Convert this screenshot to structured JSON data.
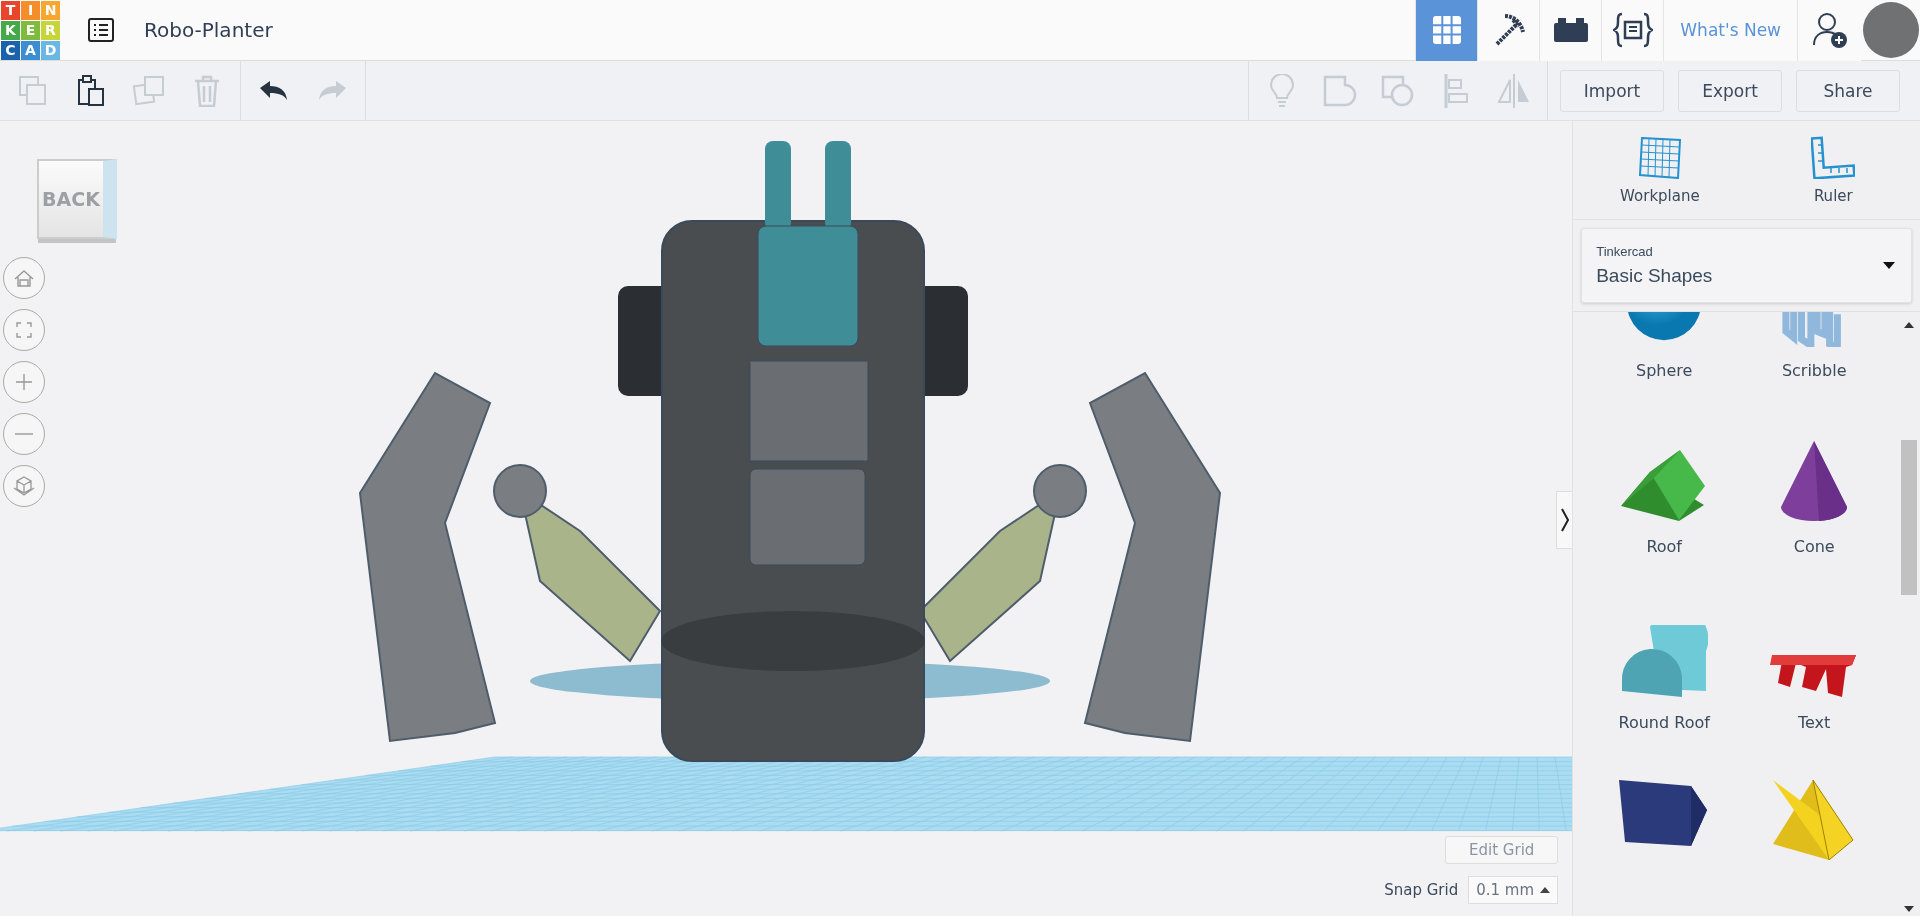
{
  "header": {
    "logo": [
      {
        "letter": "T",
        "color": "#e8452c"
      },
      {
        "letter": "I",
        "color": "#f58d2b"
      },
      {
        "letter": "N",
        "color": "#f7a632"
      },
      {
        "letter": "K",
        "color": "#45a949"
      },
      {
        "letter": "E",
        "color": "#7fbb3f"
      },
      {
        "letter": "R",
        "color": "#c6d53a"
      },
      {
        "letter": "C",
        "color": "#1b62ad"
      },
      {
        "letter": "A",
        "color": "#3c8ed1"
      },
      {
        "letter": "D",
        "color": "#6ab7e4"
      }
    ],
    "title": "Robo-Planter",
    "view_modes": [
      {
        "kind": "design",
        "selected": true
      },
      {
        "kind": "blocks",
        "selected": false
      },
      {
        "kind": "bricks",
        "selected": false
      },
      {
        "kind": "codeblocks",
        "selected": false
      }
    ],
    "whats_new": "What's New"
  },
  "toolbar": {
    "edit_tools": [
      {
        "kind": "copy",
        "disabled": true
      },
      {
        "kind": "paste",
        "disabled": false
      },
      {
        "kind": "duplicate",
        "disabled": true
      },
      {
        "kind": "delete",
        "disabled": true
      }
    ],
    "history_tools": [
      {
        "kind": "undo",
        "disabled": false
      },
      {
        "kind": "redo",
        "disabled": true
      }
    ],
    "shape_tools": [
      {
        "kind": "note",
        "disabled": true
      },
      {
        "kind": "group",
        "disabled": true
      },
      {
        "kind": "ungroup",
        "disabled": true
      },
      {
        "kind": "align",
        "disabled": true
      },
      {
        "kind": "mirror",
        "disabled": true
      }
    ],
    "buttons": [
      "Import",
      "Export",
      "Share"
    ]
  },
  "viewport": {
    "view_cube": "BACK",
    "controls": [
      {
        "kind": "home"
      },
      {
        "kind": "fit"
      },
      {
        "kind": "zoom_in"
      },
      {
        "kind": "zoom_out"
      },
      {
        "kind": "projection"
      }
    ],
    "edit_grid": "Edit Grid",
    "snap_grid_label": "Snap Grid",
    "snap_grid_value": "0.1 mm"
  },
  "panel": {
    "tools": [
      {
        "kind": "workplane",
        "label": "Workplane"
      },
      {
        "kind": "ruler",
        "label": "Ruler"
      }
    ],
    "category": {
      "library": "Tinkercad",
      "name": "Basic Shapes"
    },
    "shapes": [
      {
        "kind": "sphere",
        "label": "Sphere"
      },
      {
        "kind": "scribble",
        "label": "Scribble"
      },
      {
        "kind": "roof",
        "label": "Roof"
      },
      {
        "kind": "cone",
        "label": "Cone"
      },
      {
        "kind": "round_roof",
        "label": "Round Roof"
      },
      {
        "kind": "text",
        "label": "Text"
      },
      {
        "kind": "wedge"
      },
      {
        "kind": "pyramid"
      }
    ]
  }
}
